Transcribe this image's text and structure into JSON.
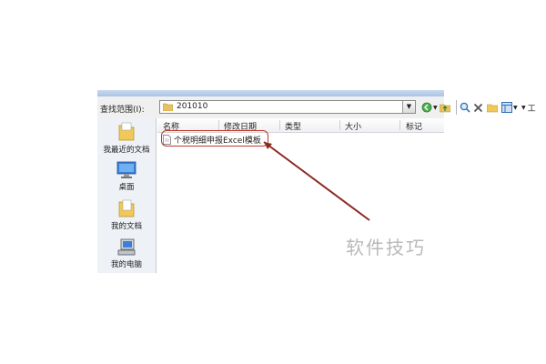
{
  "lookin": {
    "label": "查找范围(I):",
    "value": "201010"
  },
  "toolbar": {
    "tools_label": "工"
  },
  "places": [
    {
      "label": "我最近的文档"
    },
    {
      "label": "桌面"
    },
    {
      "label": "我的文档"
    },
    {
      "label": "我的电脑"
    }
  ],
  "columns": [
    "名称",
    "修改日期",
    "类型",
    "大小",
    "标记"
  ],
  "files": [
    {
      "name": "个税明细申报Excel模板"
    }
  ],
  "watermark": "软件技巧",
  "colors": {
    "highlight": "#c0392b",
    "arrow": "#8b2a22"
  }
}
